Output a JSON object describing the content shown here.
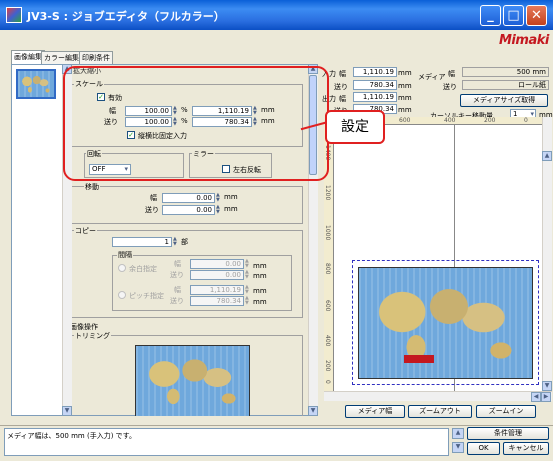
{
  "window": {
    "title": "JV3-S : ジョブエディタ（フルカラー）",
    "brand": "Mimaki",
    "min_label": "_",
    "max_label": "□",
    "close_label": "✕"
  },
  "tabs": [
    {
      "label": "画像編集"
    },
    {
      "label": "カラー編集"
    },
    {
      "label": "印刷条件"
    }
  ],
  "props": {
    "section_partial": "拡大縮小",
    "scale": {
      "title": "スケール",
      "enabled_label": "有効",
      "width_label": "幅",
      "feed_label": "送り",
      "width_percent": "100.00",
      "feed_percent": "100.00",
      "percent_unit": "%",
      "width_mm": "1,110.19",
      "feed_mm": "780.34",
      "mm_unit": "mm",
      "lock_ratio_label": "縦横比固定入力"
    },
    "rotation": {
      "title": "回転",
      "value": "OFF"
    },
    "mirror": {
      "title": "ミラー",
      "flip_label": "左右反転"
    },
    "move": {
      "title": "移動",
      "width_label": "幅",
      "feed_label": "送り",
      "width_value": "0.00",
      "feed_value": "0.00",
      "unit": "mm"
    },
    "copy": {
      "title": "コピー",
      "count": "1",
      "count_unit": "部",
      "interval_title": "間隔",
      "auto_label": "余白指定",
      "pitch_label": "ピッチ指定",
      "width_label": "幅",
      "feed_label": "送り",
      "auto_width": "0.00",
      "auto_feed": "0.00",
      "pitch_width": "1,110.19",
      "pitch_feed": "780.34",
      "unit": "mm"
    },
    "image_ops": {
      "title": "画像操作",
      "trim_label": "トリミング"
    }
  },
  "right": {
    "input_label": "入力",
    "width_label": "幅",
    "feed_label": "送り",
    "output_label": "出力",
    "input_width": "1,110.19",
    "input_feed": "780.34",
    "output_width": "1,110.19",
    "output_feed": "780.34",
    "mm_unit": "mm",
    "media_label": "メディア",
    "media_width_label": "幅",
    "media_feed_label": "送り",
    "media_width": "500 mm",
    "media_feed": "ロール紙",
    "get_media_size_button": "メディアサイズ取得",
    "cursor_step_label": "カーソルキー移動量",
    "cursor_step_value": "1",
    "cursor_step_unit": "mm",
    "ruler_ticks_top": [
      "600",
      "400",
      "200",
      "0"
    ],
    "ruler_ticks_left": [
      "1400",
      "1200",
      "1000",
      "800",
      "600",
      "400",
      "200",
      "0"
    ],
    "media_width_button": "メディア幅",
    "zoom_out_button": "ズームアウト",
    "zoom_in_button": "ズームイン"
  },
  "status": {
    "message": "メディア幅は、500 mm (手入力) です。",
    "condition_button": "条件管理",
    "ok_button": "OK",
    "cancel_button": "キャンセル"
  },
  "annotation": {
    "callout_text": "設定"
  },
  "colors": {
    "titlebar": "#2a6ee0",
    "annotation_red": "#e02020",
    "brand_red": "#c41820"
  }
}
